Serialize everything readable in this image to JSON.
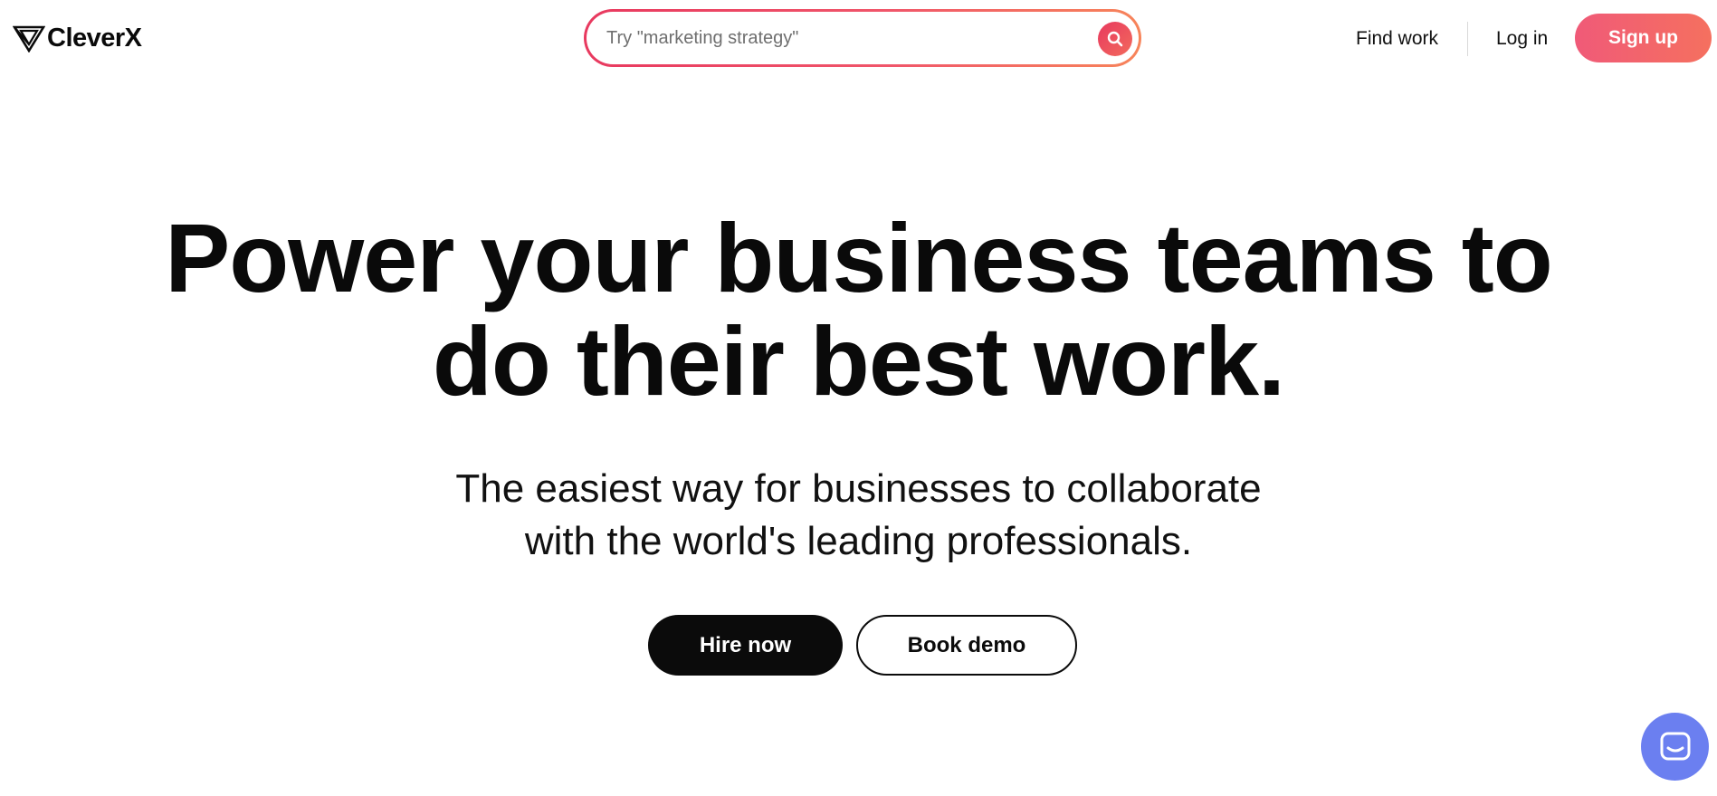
{
  "brand": {
    "name": "CleverX",
    "logo_icon": "cleverx-triangle-logo"
  },
  "search": {
    "placeholder": "Try \"marketing strategy\"",
    "value": "",
    "icon": "search-icon"
  },
  "nav": {
    "find_work": "Find work",
    "log_in": "Log in",
    "sign_up": "Sign up"
  },
  "hero": {
    "title_lines": [
      "Power your business teams to",
      "do their best work."
    ],
    "subtitle_lines": [
      "The easiest way for businesses to collaborate",
      "with the world's leading professionals."
    ],
    "primary_cta": "Hire now",
    "secondary_cta": "Book demo"
  },
  "chat": {
    "icon": "chat-icon"
  },
  "colors": {
    "accent_start": "#e8395f",
    "accent_end": "#f7845a",
    "signup_start": "#f05a78",
    "signup_end": "#f5705f",
    "primary_button": "#0b0b0b",
    "chat_launcher": "#6b7ff0",
    "text": "#0a0a0a"
  }
}
